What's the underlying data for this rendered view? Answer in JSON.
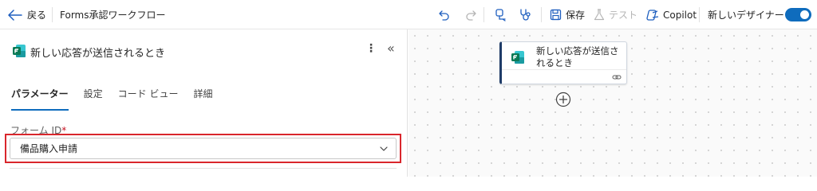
{
  "toolbar": {
    "back_label": "戻る",
    "flow_name": "Forms承認ワークフロー",
    "save_label": "保存",
    "test_label": "テスト",
    "copilot_label": "Copilot",
    "new_designer_label": "新しいデザイナー",
    "new_designer_enabled": true
  },
  "panel": {
    "title": "新しい応答が送信されるとき",
    "tabs": [
      {
        "label": "パラメーター",
        "active": true
      },
      {
        "label": "設定",
        "active": false
      },
      {
        "label": "コード ビュー",
        "active": false
      },
      {
        "label": "詳細",
        "active": false
      }
    ],
    "form_id": {
      "label": "フォーム ID",
      "required_mark": "*",
      "value": "備品購入申請"
    }
  },
  "canvas": {
    "node": {
      "title": "新しい応答が送信されるとき"
    }
  },
  "colors": {
    "accent": "#0f6cbd",
    "highlight": "#d9262c",
    "forms_green": "#0b7a55"
  }
}
